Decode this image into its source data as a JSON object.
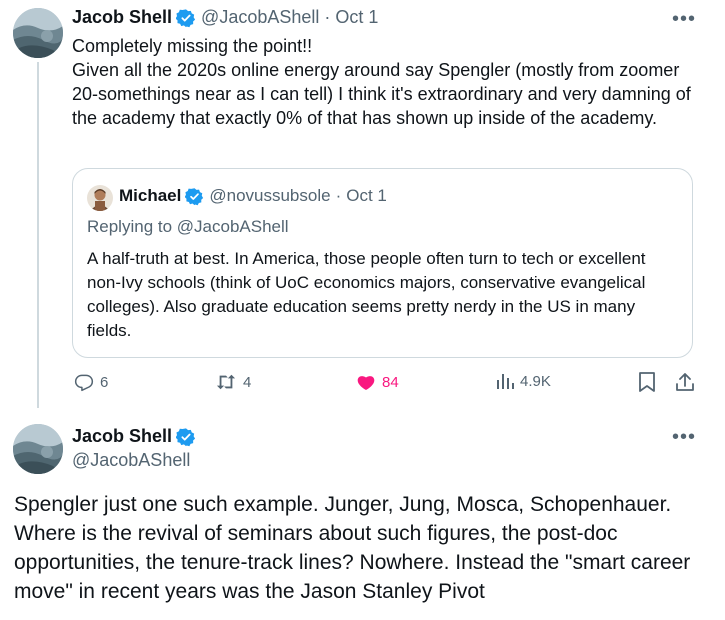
{
  "tweet1": {
    "display_name": "Jacob Shell",
    "handle": "@JacobAShell",
    "separator": "·",
    "date": "Oct 1",
    "text": "Completely missing the point!!\nGiven all the 2020s online energy around say Spengler (mostly from zoomer 20-somethings near as I can tell) I think it's extraordinary and very damning of the academy that exactly 0% of that has shown up inside of the academy.",
    "more_icon": "more-icon",
    "quote": {
      "display_name": "Michael",
      "handle": "@novussubsole",
      "separator": "·",
      "date": "Oct 1",
      "replying_to": "Replying to @JacobAShell",
      "text": "A half-truth at best. In America, those people often turn to tech or excellent non-Ivy schools (think of UoC economics majors, conservative evangelical colleges). Also graduate education seems pretty nerdy in the US in many fields."
    },
    "actions": {
      "replies": "6",
      "retweets": "4",
      "likes": "84",
      "views": "4.9K"
    }
  },
  "tweet2": {
    "display_name": "Jacob Shell",
    "handle": "@JacobAShell",
    "text": "Spengler just one such example. Junger, Jung, Mosca, Schopenhauer. Where is the revival of seminars about such figures, the post-doc opportunities, the tenure-track lines? Nowhere.  Instead the \"smart career move\" in recent years was the Jason Stanley Pivot"
  },
  "colors": {
    "verified": "#1d9bf0",
    "muted": "#536471",
    "like": "#f91880",
    "border": "#cfd9de"
  }
}
